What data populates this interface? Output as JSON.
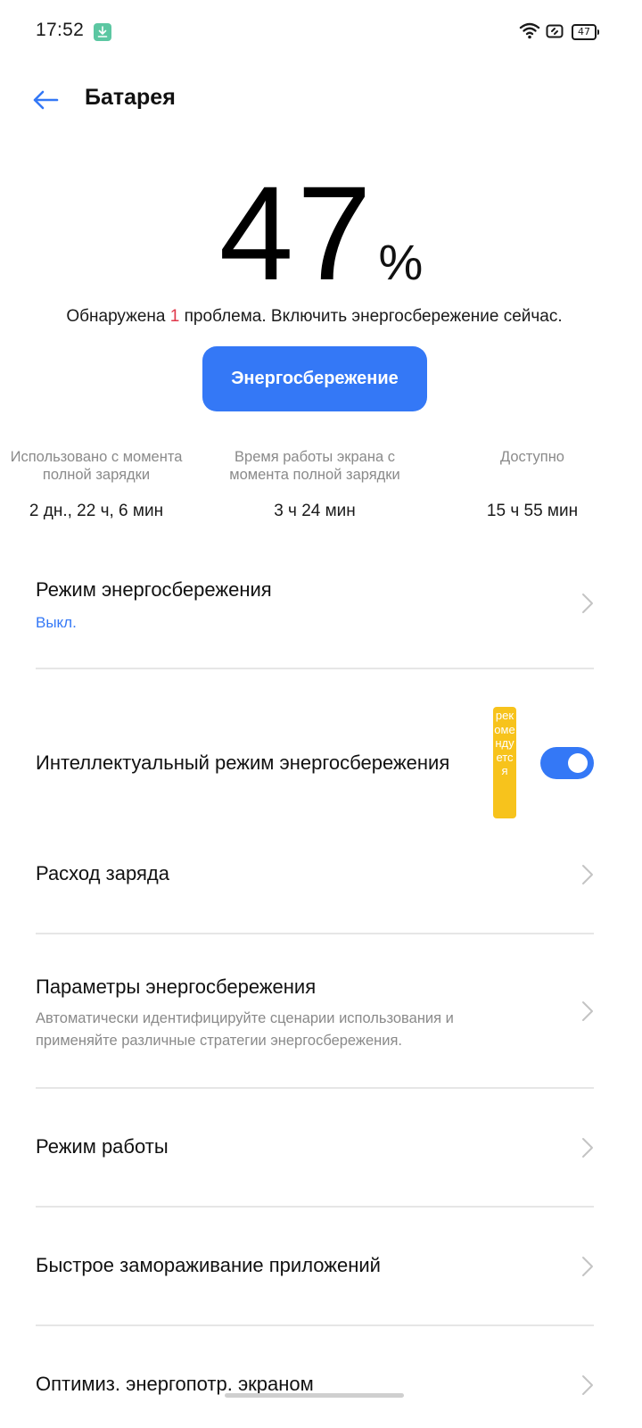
{
  "status_bar": {
    "time": "17:52",
    "battery_level": "47"
  },
  "header": {
    "title": "Батарея"
  },
  "battery": {
    "percent": "47",
    "unit": "%"
  },
  "issue": {
    "prefix": "Обнаружена ",
    "count": "1",
    "suffix": " проблема. Включить энергосбережение сейчас."
  },
  "saver_button": {
    "label": "Энергосбережение"
  },
  "stats": [
    {
      "label": "Использовано с момента полной зарядки",
      "value": "2 дн., 22 ч, 6 мин"
    },
    {
      "label": "Время работы экрана с момента полной зарядки",
      "value": "3 ч 24 мин"
    },
    {
      "label": "Доступно",
      "value": "15 ч 55 мин"
    }
  ],
  "list": {
    "power_saving_mode": {
      "title": "Режим энергосбережения",
      "status": "Выкл."
    },
    "smart_power_saving": {
      "title": "Интеллектуальный режим энергосбережения",
      "badge": "рекомендуется",
      "enabled": true
    },
    "battery_usage": {
      "title": "Расход заряда"
    },
    "power_saving_settings": {
      "title": "Параметры энергосбережения",
      "description": "Автоматически идентифицируйте сценарии использования и применяйте различные стратегии энергосбережения."
    },
    "performance_mode": {
      "title": "Режим работы"
    },
    "app_quick_freeze": {
      "title": "Быстрое замораживание приложений"
    },
    "screen_power_optimization": {
      "title": "Оптимиз. энергопотр. экраном"
    }
  },
  "colors": {
    "accent": "#3478f6",
    "issue_count": "#e0374a",
    "badge": "#f7c31c",
    "muted_text": "#8a8a8a"
  },
  "icons": {
    "back": "arrow-left-icon",
    "chevron": "chevron-right-icon",
    "wifi": "wifi-icon",
    "nfc": "nfc-icon",
    "battery": "battery-icon",
    "download": "download-icon"
  }
}
